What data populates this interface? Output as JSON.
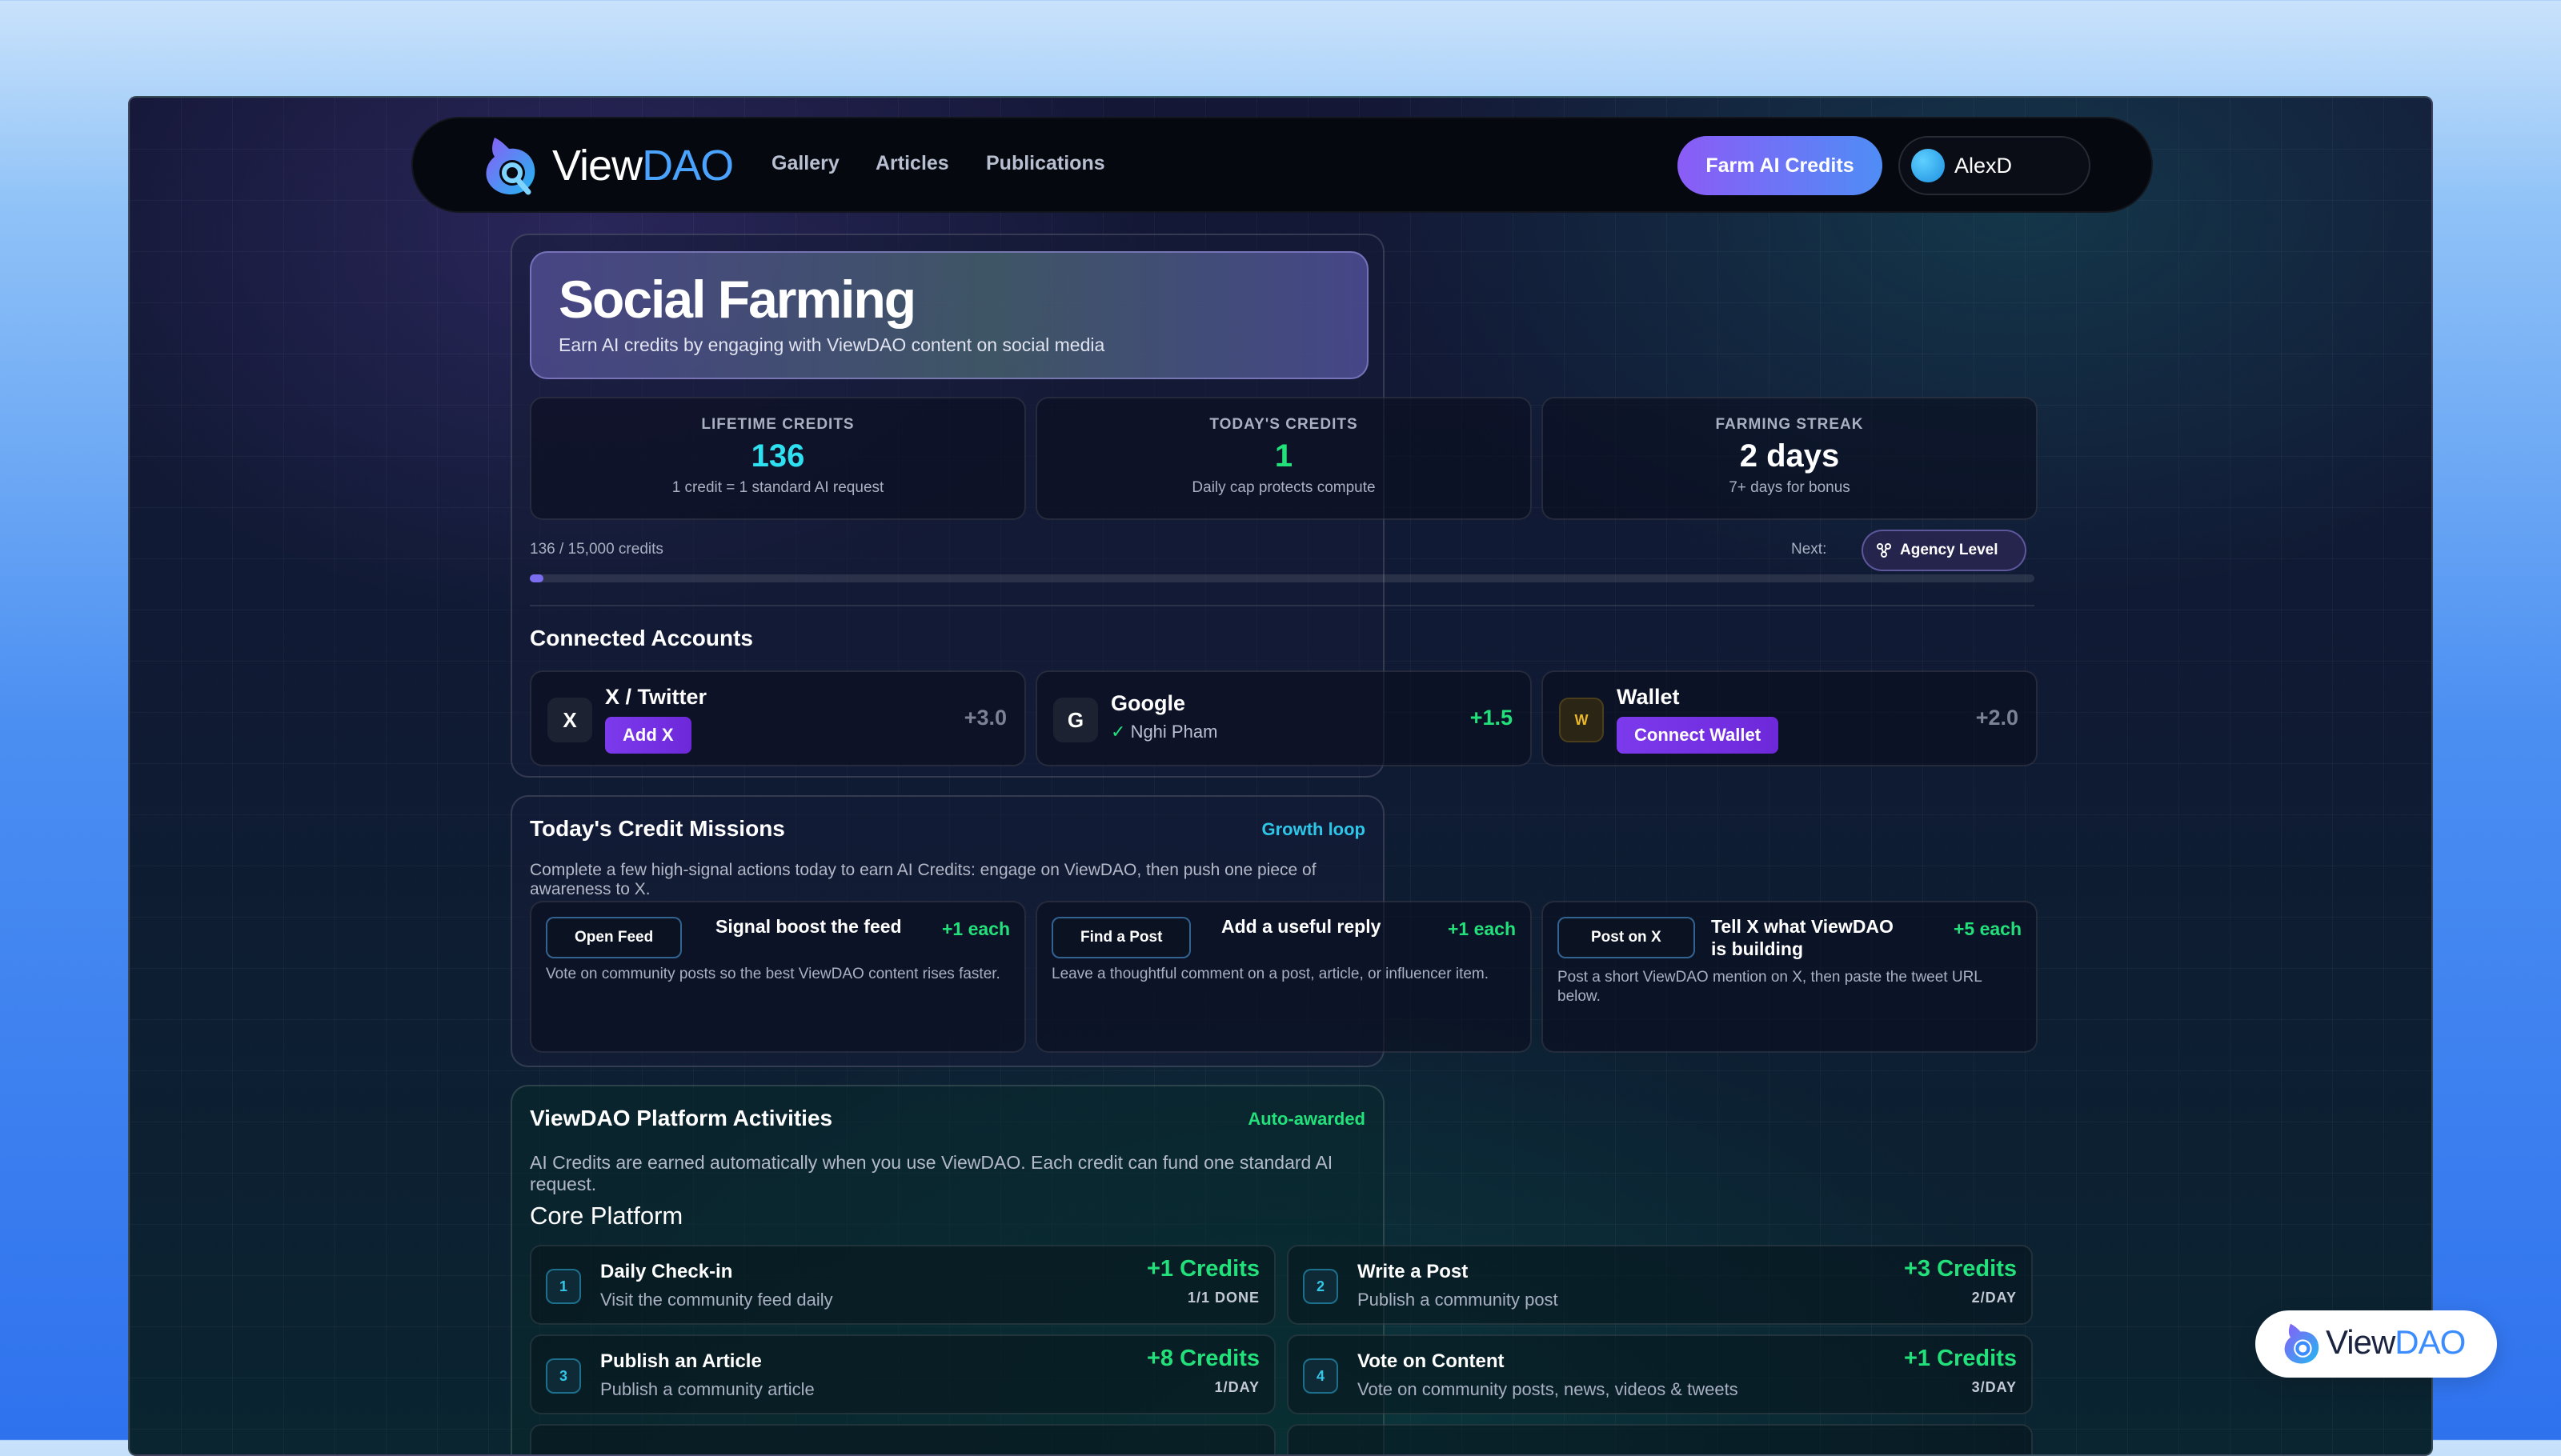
{
  "nav": {
    "brand_view": "View",
    "brand_dao": "DAO",
    "links": [
      "Gallery",
      "Articles",
      "Publications"
    ],
    "cta": "Farm AI Credits",
    "user": "AlexD"
  },
  "hero": {
    "title": "Social Farming",
    "subtitle": "Earn AI credits by engaging with ViewDAO content on social media"
  },
  "stats": [
    {
      "label": "LIFETIME CREDITS",
      "value": "136",
      "note": "1 credit = 1 standard AI request",
      "color": "#2ee0f0"
    },
    {
      "label": "TODAY'S CREDITS",
      "value": "1",
      "note": "Daily cap protects compute",
      "color": "#22e07a"
    },
    {
      "label": "FARMING STREAK",
      "value": "2 days",
      "note": "7+ days for bonus",
      "color": "#ffffff"
    }
  ],
  "progress": {
    "text": "136 / 15,000 credits",
    "fraction": 0.0091,
    "next_label": "Next:",
    "next_level": "Agency Level"
  },
  "connected": {
    "heading": "Connected Accounts",
    "accounts": [
      {
        "icon": "X",
        "name": "X / Twitter",
        "button": "Add X",
        "value": "+3.0",
        "value_color": "#7b8294"
      },
      {
        "icon": "G",
        "name": "Google",
        "status_check": "✓",
        "status": "Nghi Pham",
        "value": "+1.5",
        "value_color": "#22e07a"
      },
      {
        "icon": "W",
        "name": "Wallet",
        "button": "Connect Wallet",
        "value": "+2.0",
        "value_color": "#7b8294"
      }
    ]
  },
  "missions": {
    "heading": "Today's Credit Missions",
    "tag": "Growth loop",
    "description": "Complete a few high-signal actions today to earn AI Credits: engage on ViewDAO, then push one piece of awareness to X.",
    "items": [
      {
        "button": "Open Feed",
        "title": "Signal boost the feed",
        "reward": "+1 each",
        "desc": "Vote on community posts so the best ViewDAO content rises faster."
      },
      {
        "button": "Find a Post",
        "title": "Add a useful reply",
        "reward": "+1 each",
        "desc": "Leave a thoughtful comment on a post, article, or influencer item."
      },
      {
        "button": "Post on X",
        "title": "Tell X what ViewDAO is building",
        "reward": "+5 each",
        "desc": "Post a short ViewDAO mention on X, then paste the tweet URL below."
      }
    ]
  },
  "activities": {
    "heading": "ViewDAO Platform Activities",
    "tag": "Auto-awarded",
    "description": "AI Credits are earned automatically when you use ViewDAO. Each credit can fund one standard AI request.",
    "subheading": "Core Platform",
    "items": [
      {
        "num": "1",
        "title": "Daily Check-in",
        "desc": "Visit the community feed daily",
        "credit": "+1 Credits",
        "limit": "1/1 DONE"
      },
      {
        "num": "2",
        "title": "Write a Post",
        "desc": "Publish a community post",
        "credit": "+3 Credits",
        "limit": "2/DAY"
      },
      {
        "num": "3",
        "title": "Publish an Article",
        "desc": "Publish a community article",
        "credit": "+8 Credits",
        "limit": "1/DAY"
      },
      {
        "num": "4",
        "title": "Vote on Content",
        "desc": "Vote on community posts, news, videos & tweets",
        "credit": "+1 Credits",
        "limit": "3/DAY"
      }
    ]
  },
  "watermark": {
    "view": "View",
    "dao": "DAO"
  }
}
